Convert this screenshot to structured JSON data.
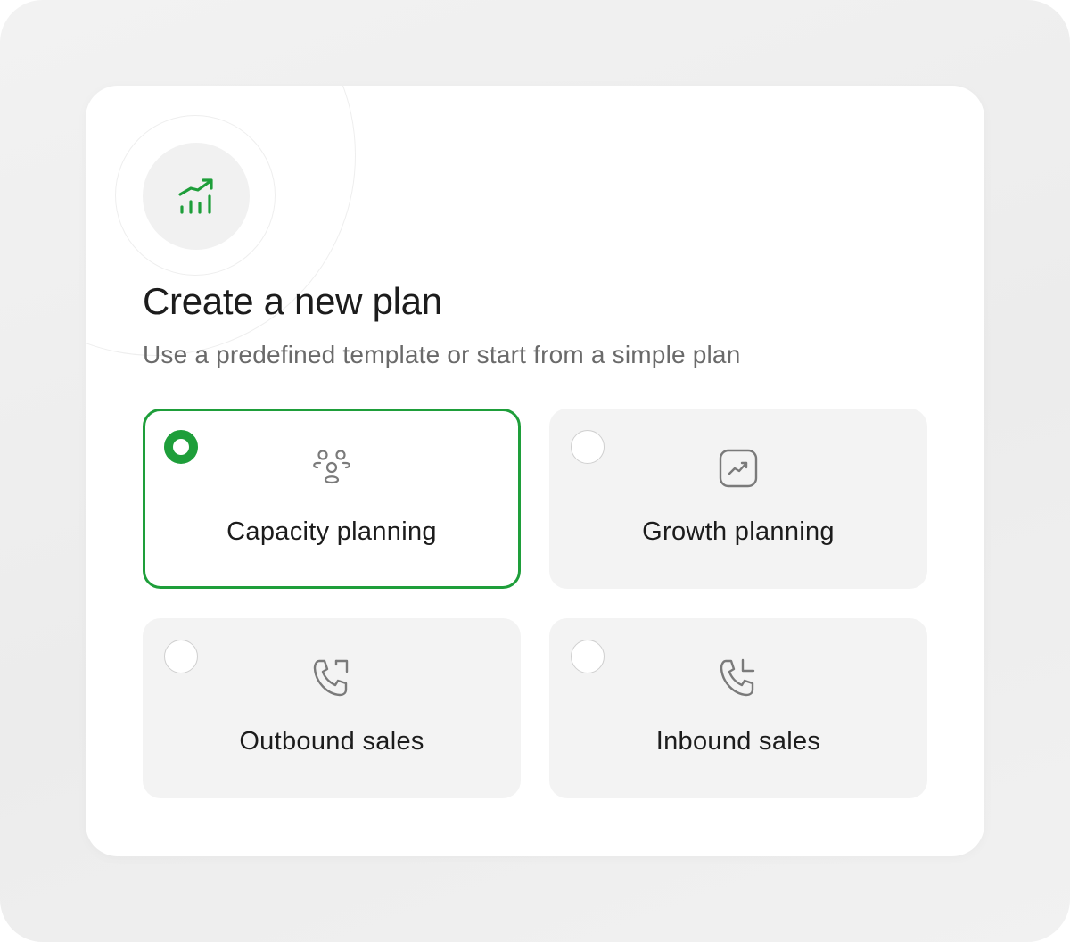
{
  "header": {
    "title": "Create a new plan",
    "subtitle": "Use a predefined template or start from a simple plan",
    "icon": "chart-trend-up-icon"
  },
  "options": [
    {
      "label": "Capacity planning",
      "icon": "users-group-icon",
      "selected": true
    },
    {
      "label": "Growth planning",
      "icon": "trend-square-icon",
      "selected": false
    },
    {
      "label": "Outbound sales",
      "icon": "phone-outgoing-icon",
      "selected": false
    },
    {
      "label": "Inbound sales",
      "icon": "phone-incoming-icon",
      "selected": false
    }
  ],
  "colors": {
    "accent": "#1e9e3a",
    "option_bg": "#f3f3f3",
    "text": "#1c1c1c",
    "muted": "#6a6a6a"
  }
}
